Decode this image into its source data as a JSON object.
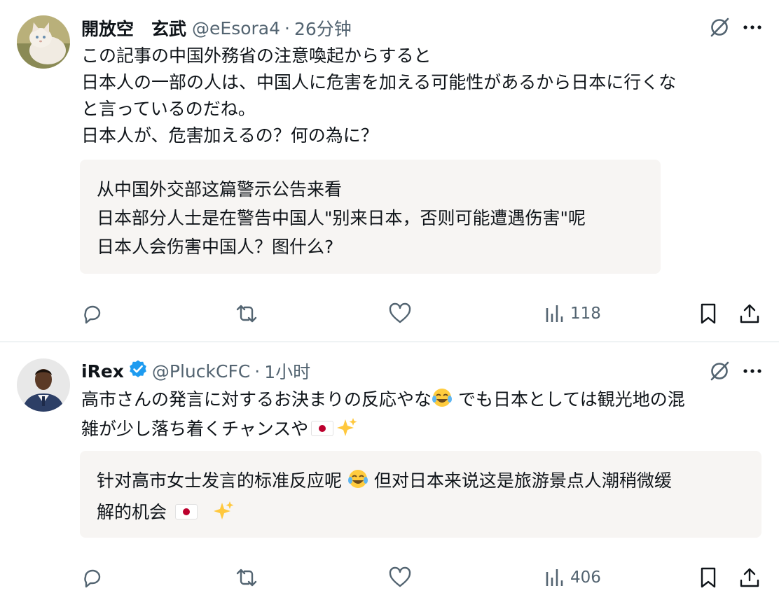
{
  "tweets": [
    {
      "display_name": "開放空　玄武",
      "handle": "@eEsora4",
      "separator": "·",
      "time": "26分钟",
      "verified": false,
      "text_lines": [
        "この記事の中国外務省の注意喚起からすると",
        "日本人の一部の人は、中国人に危害を加える可能性があるから日本に行くな",
        "と言っているのだね。",
        "日本人が、危害加えるの？何の為に？"
      ],
      "translation_lines": [
        "从中国外交部这篇警示公告来看",
        "日本部分人士是在警告中国人\"别来日本，否则可能遭遇伤害\"呢",
        "日本人会伤害中国人？图什么?"
      ],
      "views": "118"
    },
    {
      "display_name": "iRex",
      "handle": "@PluckCFC",
      "separator": "·",
      "time": "1小时",
      "verified": true,
      "text_line1_a": "高市さんの発言に対するお決まりの反応やな",
      "text_line1_b": " でも日本としては観光地の混",
      "text_line2": "雑が少し落ち着くチャンスや",
      "translation_line1_a": "针对高市女士发言的标准反应呢 ",
      "translation_line1_b": " 但对日本来说这是旅游景点人潮稍微缓",
      "translation_line2": "解的机会 ",
      "views": "406"
    }
  ],
  "colors": {
    "text": "#0f1419",
    "secondary": "#536471",
    "verified": "#1d9bf0",
    "translation_bg": "#f7f5f3",
    "flag_red": "#bc002d"
  },
  "icons": [
    "grok-icon",
    "more-icon",
    "reply-icon",
    "retweet-icon",
    "like-icon",
    "views-icon",
    "bookmark-icon",
    "share-icon",
    "verified-badge-icon",
    "tears-of-joy-emoji",
    "japan-flag-emoji",
    "sparkles-emoji"
  ]
}
